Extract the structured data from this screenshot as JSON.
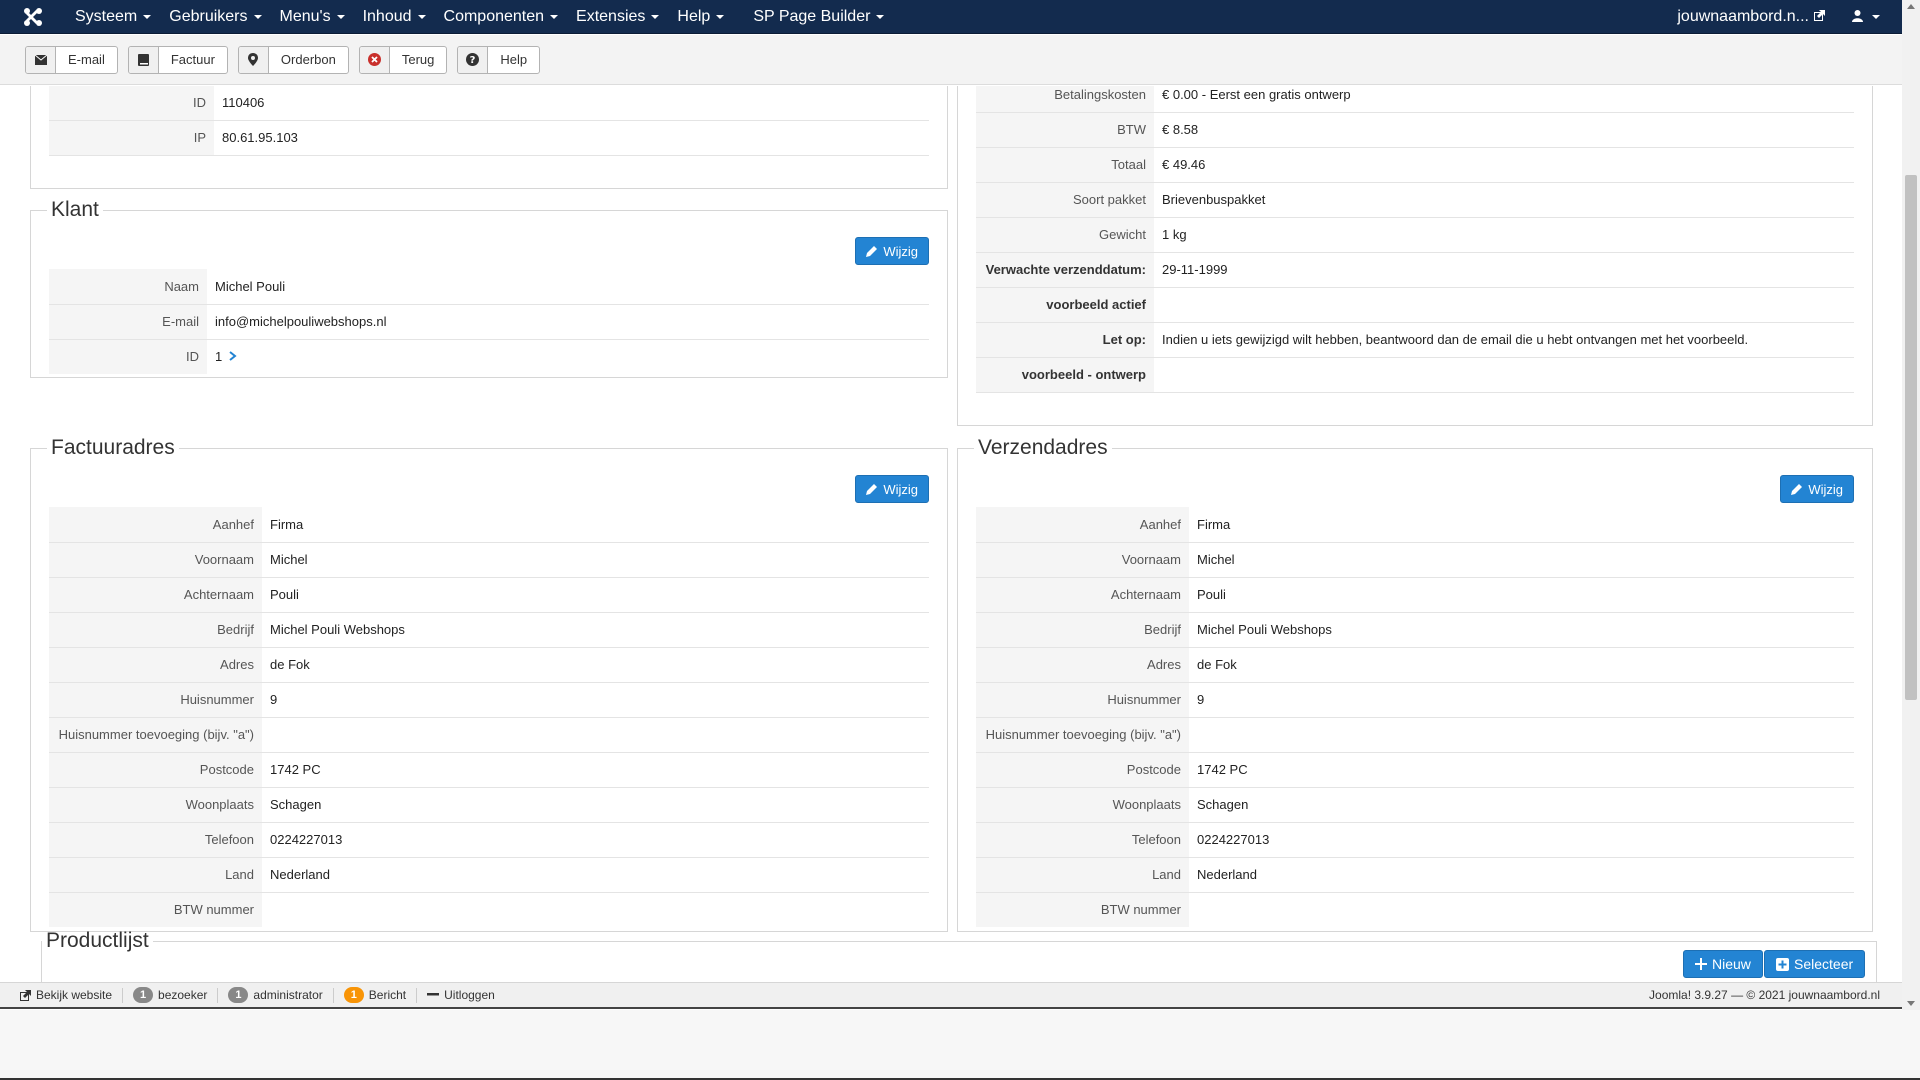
{
  "navbar": {
    "menu": [
      {
        "label": "Systeem"
      },
      {
        "label": "Gebruikers"
      },
      {
        "label": "Menu's"
      },
      {
        "label": "Inhoud"
      },
      {
        "label": "Componenten"
      },
      {
        "label": "Extensies"
      },
      {
        "label": "Help"
      },
      {
        "label": "SP Page Builder"
      }
    ],
    "site_link": "jouwnaambord.n...",
    "user_icon": "user-icon"
  },
  "toolbar": {
    "buttons": [
      {
        "label": "E-mail",
        "icon": "envelope-icon"
      },
      {
        "label": "Factuur",
        "icon": "book-icon"
      },
      {
        "label": "Orderbon",
        "icon": "location-pin-icon"
      },
      {
        "label": "Terug",
        "icon": "cancel-icon"
      },
      {
        "label": "Help",
        "icon": "question-icon"
      }
    ]
  },
  "order_info": {
    "rows": [
      {
        "label": "ID",
        "value": "110406"
      },
      {
        "label": "IP",
        "value": "80.61.95.103"
      }
    ]
  },
  "order_summary": {
    "rows": [
      {
        "label": "Betalingskosten",
        "value": "€ 0.00 - Eerst een gratis ontwerp"
      },
      {
        "label": "BTW",
        "value": "€ 8.58"
      },
      {
        "label": "Totaal",
        "value": "€ 49.46"
      },
      {
        "label": "Soort pakket",
        "value": "Brievenbuspakket"
      },
      {
        "label": "Gewicht",
        "value": "1 kg"
      },
      {
        "label": "Verwachte verzenddatum:",
        "value": "29-11-1999"
      },
      {
        "label": "voorbeeld actief",
        "value": ""
      },
      {
        "label": "Let op:",
        "value": "Indien u iets gewijzigd wilt hebben, beantwoord dan de email die u hebt ontvangen met het voorbeeld."
      },
      {
        "label": "voorbeeld - ontwerp",
        "value": ""
      }
    ]
  },
  "klant": {
    "title": "Klant",
    "edit_label": "Wijzig",
    "rows": [
      {
        "label": "Naam",
        "value": "Michel Pouli"
      },
      {
        "label": "E-mail",
        "value": "info@michelpouliwebshops.nl"
      },
      {
        "label": "ID",
        "value": "1"
      }
    ]
  },
  "factuuradres": {
    "title": "Factuuradres",
    "edit_label": "Wijzig",
    "rows": [
      {
        "label": "Aanhef",
        "value": "Firma"
      },
      {
        "label": "Voornaam",
        "value": "Michel"
      },
      {
        "label": "Achternaam",
        "value": "Pouli"
      },
      {
        "label": "Bedrijf",
        "value": "Michel Pouli Webshops"
      },
      {
        "label": "Adres",
        "value": "de Fok"
      },
      {
        "label": "Huisnummer",
        "value": "9"
      },
      {
        "label": "Huisnummer toevoeging (bijv. \"a\")",
        "value": ""
      },
      {
        "label": "Postcode",
        "value": "1742 PC"
      },
      {
        "label": "Woonplaats",
        "value": "Schagen"
      },
      {
        "label": "Telefoon",
        "value": "0224227013"
      },
      {
        "label": "Land",
        "value": "Nederland"
      },
      {
        "label": "BTW nummer",
        "value": ""
      }
    ]
  },
  "verzendadres": {
    "title": "Verzendadres",
    "edit_label": "Wijzig",
    "rows": [
      {
        "label": "Aanhef",
        "value": "Firma"
      },
      {
        "label": "Voornaam",
        "value": "Michel"
      },
      {
        "label": "Achternaam",
        "value": "Pouli"
      },
      {
        "label": "Bedrijf",
        "value": "Michel Pouli Webshops"
      },
      {
        "label": "Adres",
        "value": "de Fok"
      },
      {
        "label": "Huisnummer",
        "value": "9"
      },
      {
        "label": "Huisnummer toevoeging (bijv. \"a\")",
        "value": ""
      },
      {
        "label": "Postcode",
        "value": "1742 PC"
      },
      {
        "label": "Woonplaats",
        "value": "Schagen"
      },
      {
        "label": "Telefoon",
        "value": "0224227013"
      },
      {
        "label": "Land",
        "value": "Nederland"
      },
      {
        "label": "BTW nummer",
        "value": ""
      }
    ]
  },
  "productlijst": {
    "title": "Productlijst",
    "new_label": "Nieuw",
    "select_label": "Selecteer"
  },
  "statusbar": {
    "view_site": "Bekijk website",
    "visitors_count": "1",
    "visitors_label": "bezoeker",
    "admin_count": "1",
    "admin_label": "administrator",
    "messages_count": "1",
    "messages_label": "Bericht",
    "logout": "Uitloggen",
    "version": "Joomla! 3.9.27 — © 2021 jouwnaambord.nl"
  },
  "colors": {
    "navbar": "#132b4e",
    "primary_button": "#2384d3",
    "warning_badge": "#f89406"
  }
}
